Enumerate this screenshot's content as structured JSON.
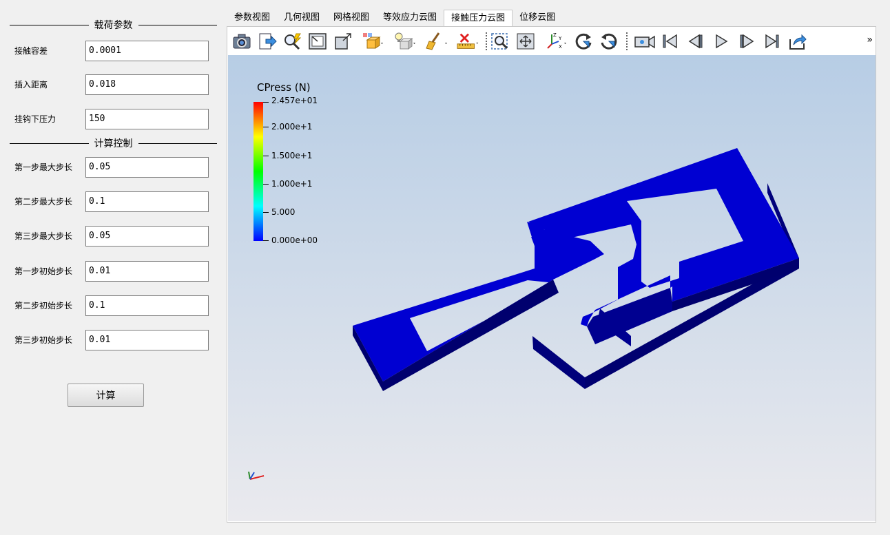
{
  "left_panel": {
    "load_section_title": "载荷参数",
    "calc_section_title": "计算控制",
    "load_fields": [
      {
        "label": "接触容差",
        "value": "0.0001"
      },
      {
        "label": "插入距离",
        "value": "0.018"
      },
      {
        "label": "挂钩下压力",
        "value": "150"
      }
    ],
    "calc_fields": [
      {
        "label": "第一步最大步长",
        "value": "0.05"
      },
      {
        "label": "第二步最大步长",
        "value": "0.1"
      },
      {
        "label": "第三步最大步长",
        "value": "0.05"
      },
      {
        "label": "第一步初始步长",
        "value": "0.01"
      },
      {
        "label": "第二步初始步长",
        "value": "0.1"
      },
      {
        "label": "第三步初始步长",
        "value": "0.01"
      }
    ],
    "compute_button": "计算"
  },
  "tabs": [
    {
      "label": "参数视图",
      "active": false
    },
    {
      "label": "几何视图",
      "active": false
    },
    {
      "label": "网格视图",
      "active": false
    },
    {
      "label": "等效应力云图",
      "active": false
    },
    {
      "label": "接触压力云图",
      "active": true
    },
    {
      "label": "位移云图",
      "active": false
    }
  ],
  "toolbar": {
    "icons": [
      "camera-icon",
      "export-icon",
      "interactive-select-icon",
      "reset-camera-icon",
      "zoom-to-box-icon",
      "orientation-cube-icon",
      "light-kit-icon",
      "clear-icon",
      "ruler-delete-icon",
      "zoom-to-data-icon",
      "pan-icon",
      "axes-triad-icon",
      "rotate-cw-icon",
      "rotate-ccw-icon",
      "video-camera-icon",
      "first-frame-icon",
      "previous-frame-icon",
      "play-icon",
      "next-frame-icon",
      "last-frame-icon",
      "share-icon"
    ],
    "overflow_label": "»"
  },
  "viewport": {
    "legend": {
      "title": "CPress (N)",
      "labels": [
        "2.457e+01",
        "2.000e+1",
        "1.500e+1",
        "1.000e+1",
        "5.000",
        "0.000e+00"
      ],
      "colors": [
        "#ff0000",
        "#ffff00",
        "#00ff00",
        "#00ffff",
        "#0000ff"
      ]
    },
    "model_color": "#0000d0"
  }
}
